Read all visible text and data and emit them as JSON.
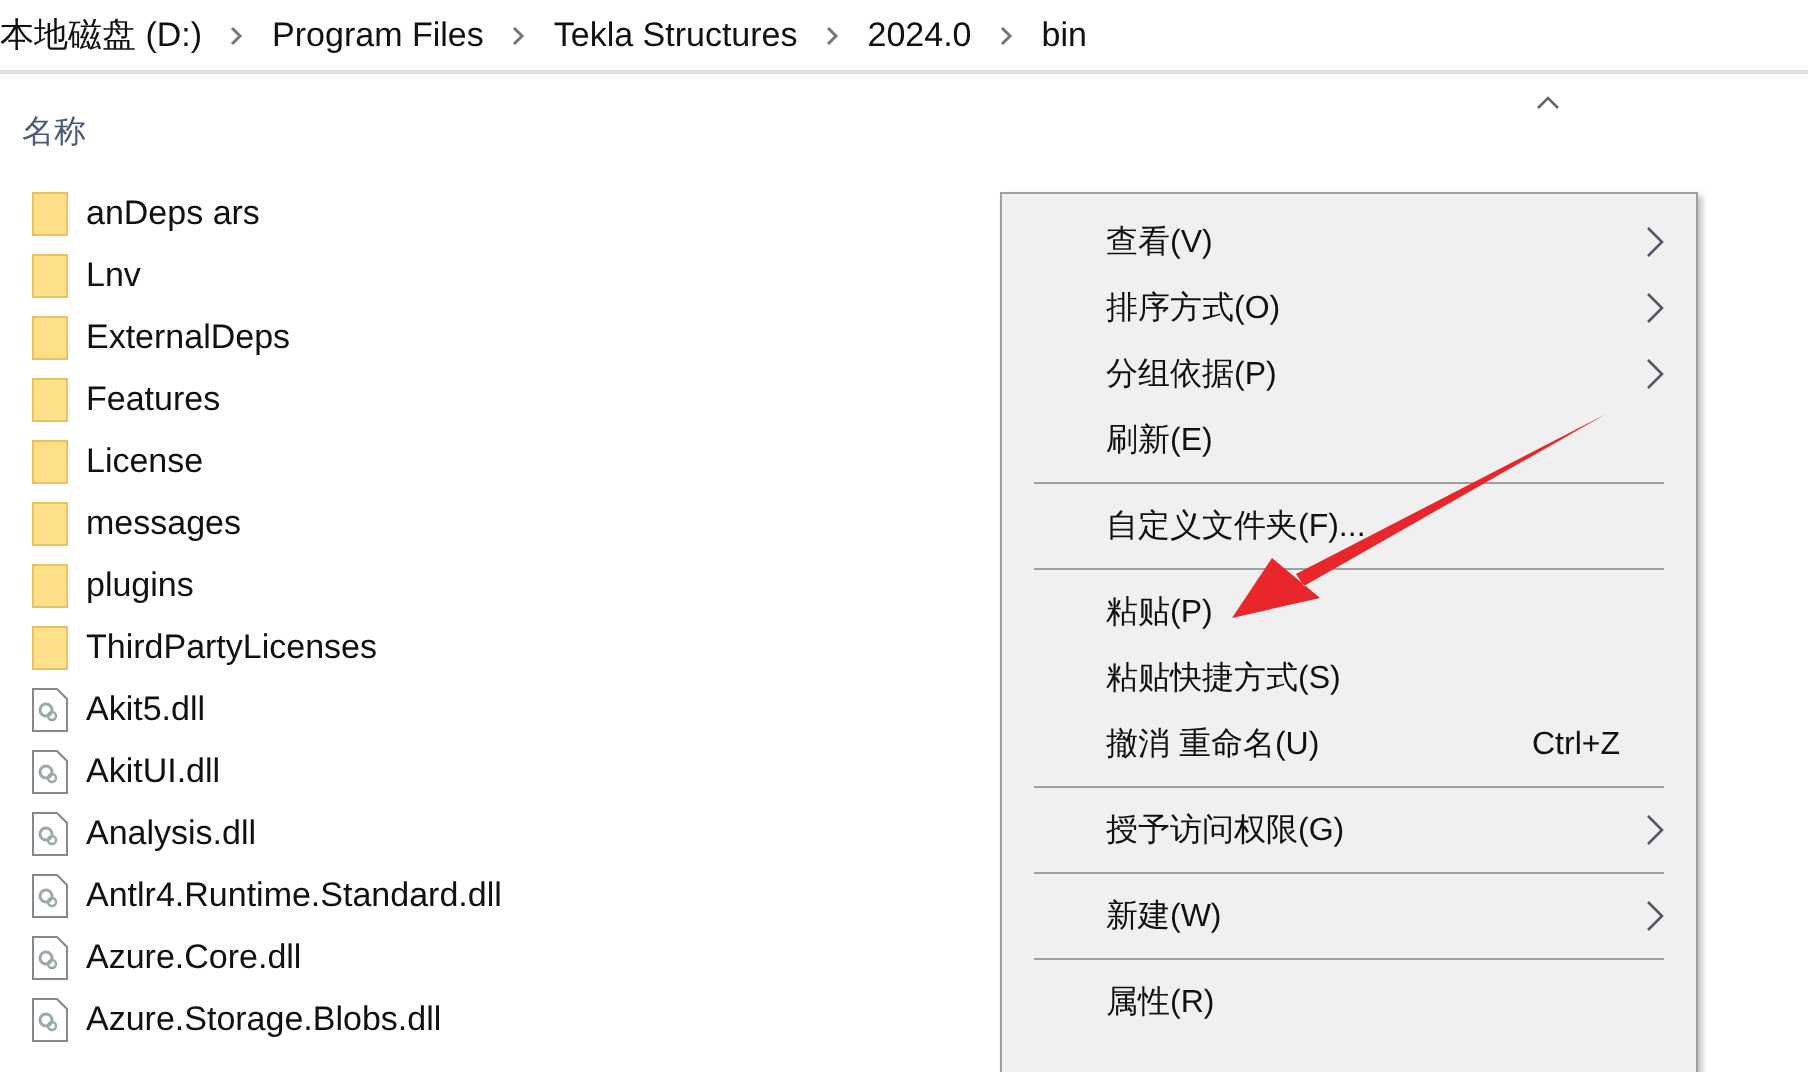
{
  "breadcrumb": [
    "本地磁盘 (D:)",
    "Program Files",
    "Tekla Structures",
    "2024.0",
    "bin"
  ],
  "column_header": "名称",
  "files": [
    {
      "name": "anDeps ars",
      "kind": "folder"
    },
    {
      "name": "Lnv",
      "kind": "folder"
    },
    {
      "name": "ExternalDeps",
      "kind": "folder"
    },
    {
      "name": "Features",
      "kind": "folder"
    },
    {
      "name": "License",
      "kind": "folder"
    },
    {
      "name": "messages",
      "kind": "folder"
    },
    {
      "name": "plugins",
      "kind": "folder"
    },
    {
      "name": "ThirdPartyLicenses",
      "kind": "folder"
    },
    {
      "name": "Akit5.dll",
      "kind": "dll"
    },
    {
      "name": "AkitUI.dll",
      "kind": "dll"
    },
    {
      "name": "Analysis.dll",
      "kind": "dll"
    },
    {
      "name": "Antlr4.Runtime.Standard.dll",
      "kind": "dll"
    },
    {
      "name": "Azure.Core.dll",
      "kind": "dll"
    },
    {
      "name": "Azure.Storage.Blobs.dll",
      "kind": "dll"
    }
  ],
  "context_menu": [
    {
      "kind": "item",
      "label": "查看(V)",
      "submenu": true
    },
    {
      "kind": "item",
      "label": "排序方式(O)",
      "submenu": true
    },
    {
      "kind": "item",
      "label": "分组依据(P)",
      "submenu": true
    },
    {
      "kind": "item",
      "label": "刷新(E)",
      "submenu": false
    },
    {
      "kind": "separator"
    },
    {
      "kind": "item",
      "label": "自定义文件夹(F)...",
      "submenu": false
    },
    {
      "kind": "separator"
    },
    {
      "kind": "item",
      "label": "粘贴(P)",
      "submenu": false
    },
    {
      "kind": "item",
      "label": "粘贴快捷方式(S)",
      "submenu": false
    },
    {
      "kind": "item",
      "label": "撤消 重命名(U)",
      "shortcut": "Ctrl+Z",
      "submenu": false
    },
    {
      "kind": "separator"
    },
    {
      "kind": "item",
      "label": "授予访问权限(G)",
      "submenu": true
    },
    {
      "kind": "separator"
    },
    {
      "kind": "item",
      "label": "新建(W)",
      "submenu": true
    },
    {
      "kind": "separator"
    },
    {
      "kind": "item",
      "label": "属性(R)",
      "submenu": false
    }
  ]
}
